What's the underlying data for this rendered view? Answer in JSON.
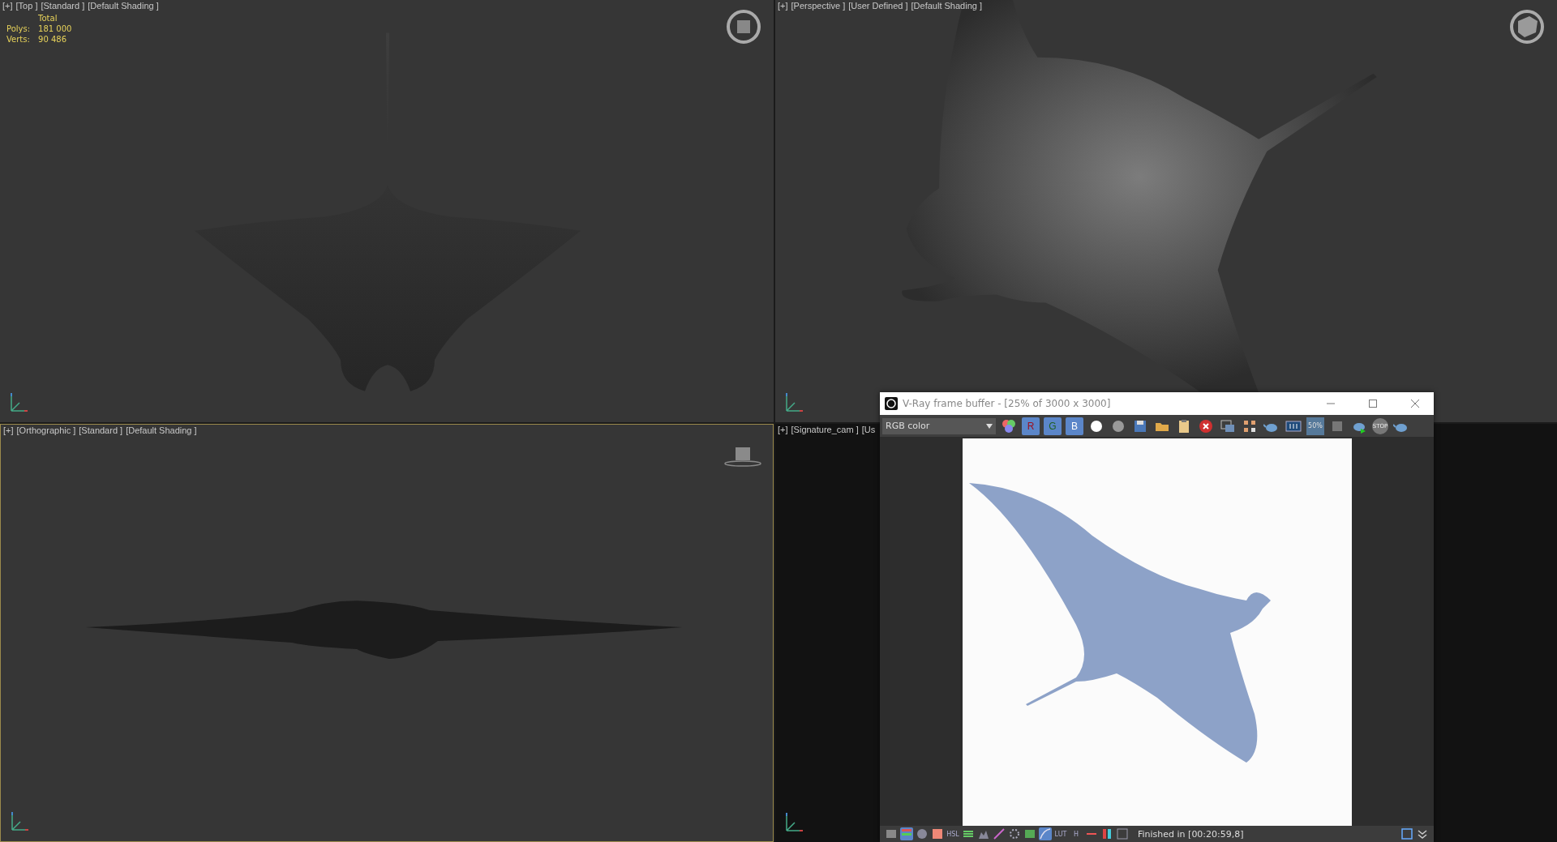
{
  "viewports": [
    {
      "kind": "top",
      "active": false,
      "menus": [
        "[+]",
        "[Top ]",
        "[Standard ]",
        "[Default Shading ]"
      ],
      "stats": {
        "title": "Total",
        "rows": [
          {
            "label": "Polys:",
            "value": "181 000"
          },
          {
            "label": "Verts:",
            "value": "90 486"
          }
        ]
      }
    },
    {
      "kind": "perspective",
      "active": false,
      "menus": [
        "[+]",
        "[Perspective ]",
        "[User Defined ]",
        "[Default Shading ]"
      ]
    },
    {
      "kind": "front",
      "active": true,
      "menus": [
        "[+]",
        "[Orthographic ]",
        "[Standard ]",
        "[Default Shading ]"
      ]
    },
    {
      "kind": "camera",
      "active": false,
      "menus": [
        "[+]",
        "[Signature_cam ]",
        "[Us"
      ]
    }
  ],
  "frame_buffer": {
    "title": "V-Ray frame buffer - [25% of 3000 x 3000]",
    "channel_select": "RGB color",
    "channel_buttons": [
      {
        "label": "R",
        "selected": true
      },
      {
        "label": "G",
        "selected": true
      },
      {
        "label": "B",
        "selected": true
      }
    ],
    "zoom_badge": "50%",
    "stop_label": "STOP",
    "bottom_tools": [
      {
        "kind": "icon",
        "selected": false
      },
      {
        "kind": "icon",
        "selected": true
      },
      {
        "kind": "icon",
        "selected": false
      },
      {
        "kind": "icon",
        "selected": false
      },
      {
        "kind": "text",
        "label": "HSL",
        "selected": false
      },
      {
        "kind": "icon",
        "selected": false
      },
      {
        "kind": "icon",
        "selected": false
      },
      {
        "kind": "icon",
        "selected": false
      },
      {
        "kind": "icon",
        "selected": false
      },
      {
        "kind": "icon",
        "selected": false
      },
      {
        "kind": "icon",
        "selected": true
      },
      {
        "kind": "text",
        "label": "LUT",
        "selected": false
      },
      {
        "kind": "text",
        "label": "H",
        "selected": false
      },
      {
        "kind": "icon",
        "selected": false
      },
      {
        "kind": "icon",
        "selected": false
      },
      {
        "kind": "icon",
        "selected": false
      }
    ],
    "status": "Finished in [00:20:59,8]"
  }
}
